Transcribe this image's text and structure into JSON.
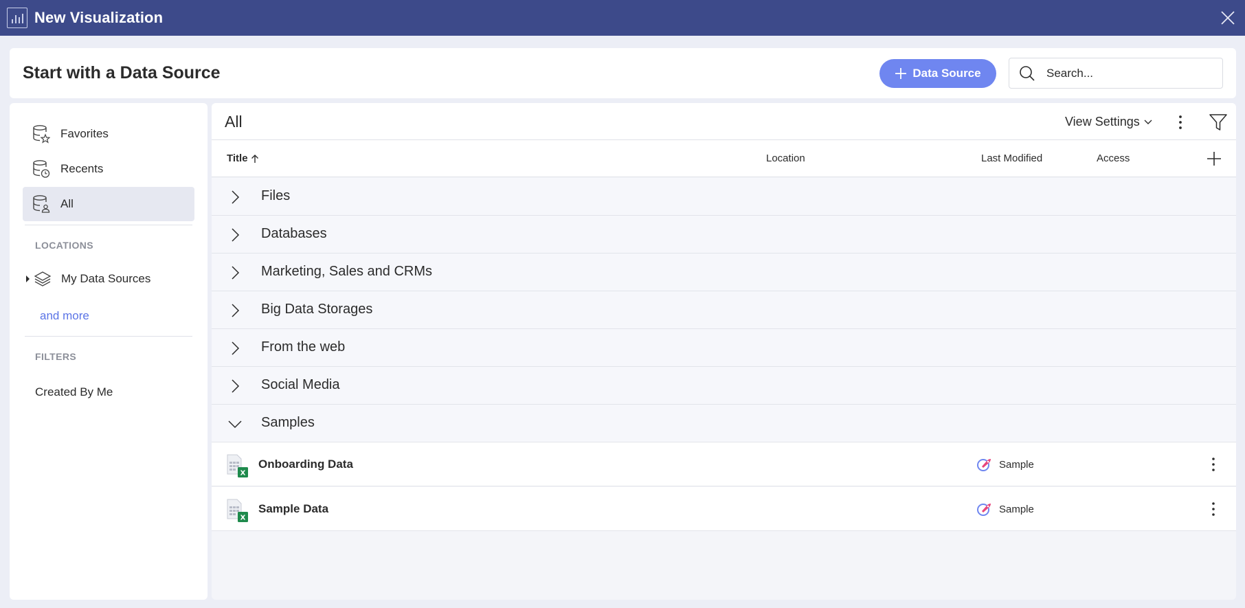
{
  "window": {
    "title": "New Visualization"
  },
  "header": {
    "heading": "Start with a Data Source",
    "add_button_label": "Data Source",
    "search_placeholder": "Search..."
  },
  "sidebar": {
    "nav": [
      {
        "label": "Favorites",
        "icon": "database-star-icon"
      },
      {
        "label": "Recents",
        "icon": "database-clock-icon"
      },
      {
        "label": "All",
        "icon": "database-user-icon",
        "active": true
      }
    ],
    "locations_label": "LOCATIONS",
    "locations": [
      {
        "label": "My Data Sources",
        "icon": "layers-icon"
      }
    ],
    "and_more": "and more",
    "filters_label": "FILTERS",
    "filters": [
      {
        "label": "Created By Me"
      }
    ]
  },
  "main": {
    "breadcrumb": "All",
    "view_settings": "View Settings",
    "columns": {
      "title": "Title",
      "location": "Location",
      "last_modified": "Last Modified",
      "access": "Access"
    },
    "groups": [
      {
        "label": "Files",
        "expanded": false
      },
      {
        "label": "Databases",
        "expanded": false
      },
      {
        "label": "Marketing, Sales and CRMs",
        "expanded": false
      },
      {
        "label": "Big Data Storages",
        "expanded": false
      },
      {
        "label": "From the web",
        "expanded": false
      },
      {
        "label": "Social Media",
        "expanded": false
      },
      {
        "label": "Samples",
        "expanded": true
      }
    ],
    "items": [
      {
        "label": "Onboarding Data",
        "access": "Sample",
        "file_badge": "X"
      },
      {
        "label": "Sample Data",
        "access": "Sample",
        "file_badge": "X"
      }
    ]
  },
  "colors": {
    "titlebar": "#3d4a8a",
    "accent": "#6f86f0",
    "link": "#5b74e6",
    "excel": "#1e8a4c"
  }
}
